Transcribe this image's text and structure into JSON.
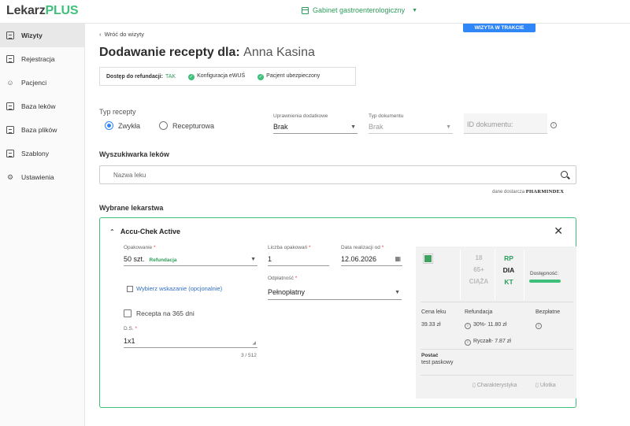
{
  "app": {
    "logo_part1": "Lekarz",
    "logo_part2": "PLUS",
    "clinic": "Gabinet gastroenterologiczny"
  },
  "sidebar": {
    "items": [
      {
        "label": "Wizyty",
        "icon": "visits-icon",
        "active": true
      },
      {
        "label": "Rejestracja",
        "icon": "calendar-icon"
      },
      {
        "label": "Pacjenci",
        "icon": "patients-icon"
      },
      {
        "label": "Baza leków",
        "icon": "drug-base-icon"
      },
      {
        "label": "Baza plików",
        "icon": "files-icon"
      },
      {
        "label": "Szablony",
        "icon": "templates-icon"
      },
      {
        "label": "Ustawienia",
        "icon": "gear-icon"
      }
    ]
  },
  "header": {
    "back": "Wróć do wizyty",
    "visit_badge": "WIZYTA W TRAKCIE",
    "title": "Dodawanie recepty dla:",
    "patient": "Anna Kasina"
  },
  "status": {
    "refund_label": "Dostęp do refundacji:",
    "refund_value": "TAK",
    "ewus": "Konfiguracja eWUŚ",
    "insured": "Pacjent ubezpieczony"
  },
  "rx": {
    "type_label": "Typ recepty",
    "opt1": "Zwykła",
    "opt2": "Recepturowa",
    "rights_label": "Uprawnienia dodatkowe",
    "rights_value": "Brak",
    "doc_type_label": "Typ dokumentu",
    "doc_type_value": "Brak",
    "doc_id_placeholder": "ID dokumentu:"
  },
  "search": {
    "section": "Wyszukiwarka leków",
    "placeholder": "Nazwa leku",
    "supplier_prefix": "dane dostarcza",
    "supplier": "PHARMINDEX"
  },
  "selected": {
    "section": "Wybrane lekarstwa",
    "drug_name": "Accu-Chek Active",
    "pack_label": "Opakowanie",
    "pack_value": "50 szt.",
    "pack_badge": "Refundacja",
    "count_label": "Liczba opakowań",
    "count_value": "1",
    "date_label": "Data realizacji od",
    "date_value": "12.06.2026",
    "indication_link": "Wybierz wskazanie (opcjonalnie)",
    "payment_label": "Odpłatność",
    "payment_value": "Pełnopłatny",
    "rx365": "Recepta na 365 dni",
    "ds_label": "D.S.",
    "ds_value": "1x1",
    "ds_counter": "3 / 512"
  },
  "info": {
    "age1": "18",
    "age2": "65+",
    "age3": "CIĄŻA",
    "kat1": "RP",
    "kat2": "DIA",
    "kat3": "KT",
    "availability": "Dostępność:",
    "price_label": "Cena leku",
    "price_value": "39.33 zł",
    "refund_label": "Refundacja",
    "refund_value": "30%- 11.80 zł",
    "lump_value": "Ryczałt- 7.87 zł",
    "free_label": "Bezpłatne",
    "form_label": "Postać",
    "form_value": "test paskowy",
    "charakterystyka": "Charakterystyka",
    "ulotka": "Ulotka"
  },
  "colors": {
    "accent_green": "#3fc07a",
    "accent_blue": "#2f86f6",
    "kat_green": "#2c9c5b"
  }
}
